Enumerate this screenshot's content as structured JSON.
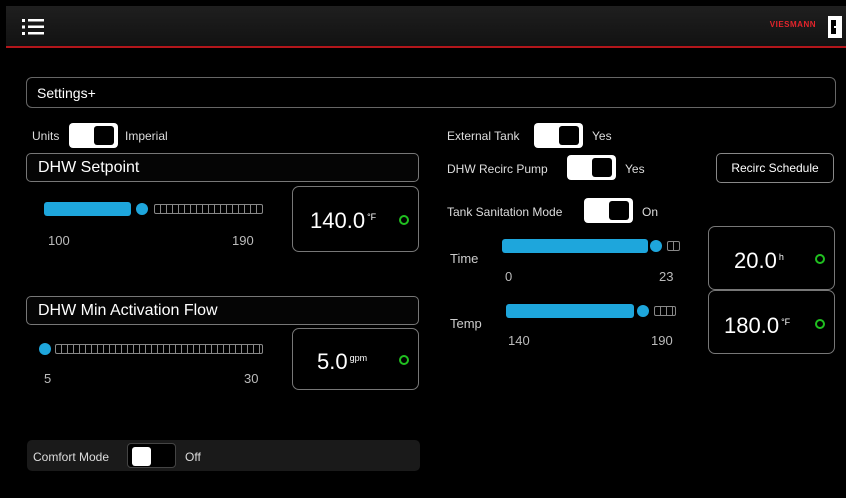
{
  "header": {
    "brand": "VIESMANN"
  },
  "page": {
    "title": "Settings+"
  },
  "units": {
    "label": "Units",
    "value": "Imperial",
    "state": "on"
  },
  "dhw_setpoint": {
    "title": "DHW Setpoint",
    "min": "100",
    "max": "190",
    "value": "140.0",
    "unit": "°F",
    "level": 0.44
  },
  "dhw_min_flow": {
    "title": "DHW Min Activation Flow",
    "min": "5",
    "max": "30",
    "value": "5.0",
    "unit": "gpm",
    "level": 0.0
  },
  "comfort_mode": {
    "label": "Comfort Mode",
    "value": "Off",
    "state": "off"
  },
  "external_tank": {
    "label": "External Tank",
    "value": "Yes",
    "state": "on"
  },
  "recirc_pump": {
    "label": "DHW Recirc Pump",
    "value": "Yes",
    "state": "on"
  },
  "recirc_schedule": {
    "label": "Recirc Schedule"
  },
  "tank_sanitation": {
    "label": "Tank Sanitation Mode",
    "value": "On",
    "state": "on"
  },
  "time": {
    "label": "Time",
    "min": "0",
    "max": "23",
    "value": "20.0",
    "unit": "h",
    "level": 0.87
  },
  "temp": {
    "label": "Temp",
    "min": "140",
    "max": "190",
    "value": "180.0",
    "unit": "°F",
    "level": 0.8
  },
  "colors": {
    "accent": "#1ea6dc",
    "brand_red": "#e3242b",
    "status_green": "#20c020"
  },
  "icons": {
    "menu": "menu-icon",
    "exit": "exit-door-icon"
  }
}
